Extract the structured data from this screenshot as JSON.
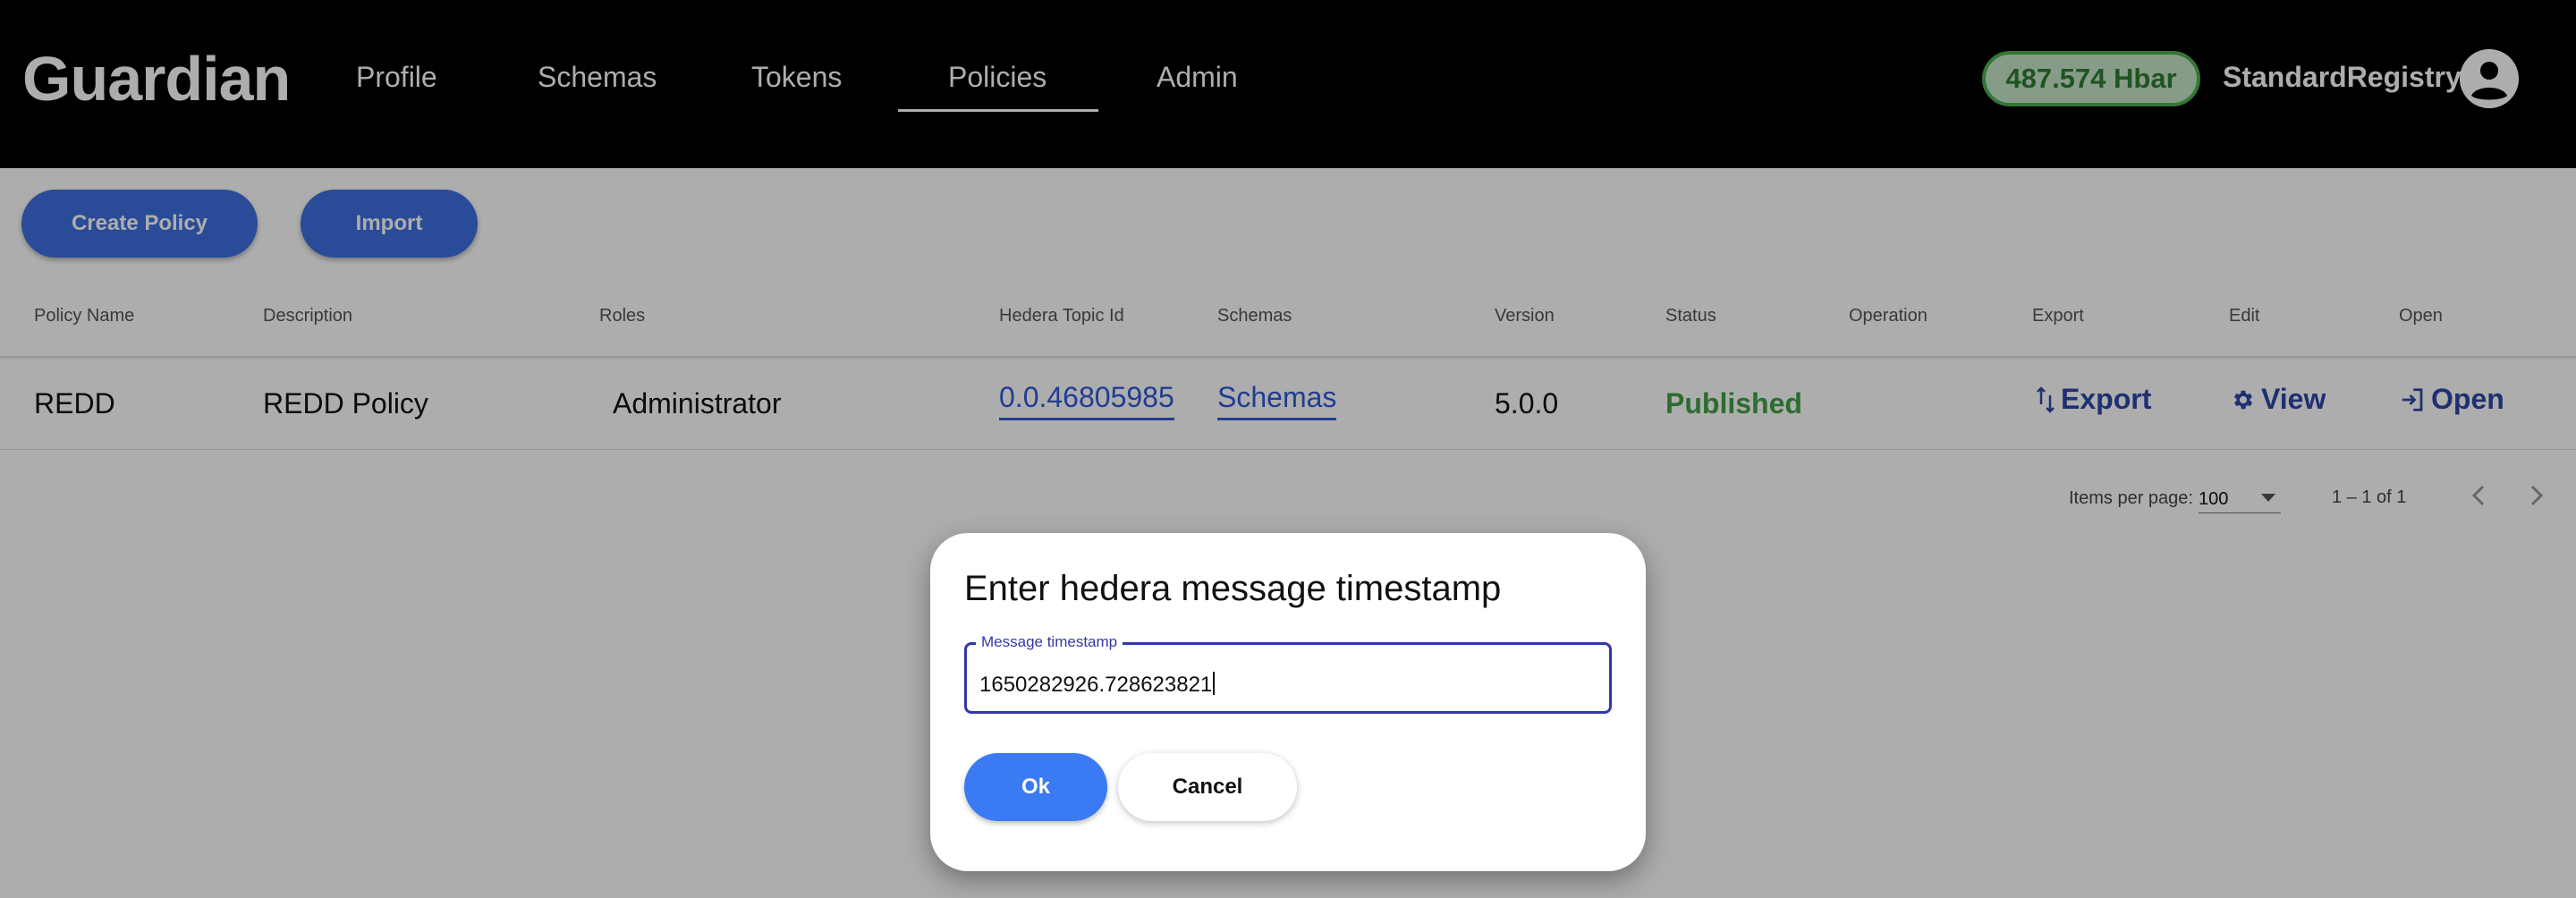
{
  "header": {
    "logo": "Guardian",
    "nav": [
      "Profile",
      "Schemas",
      "Tokens",
      "Policies",
      "Admin"
    ],
    "active_nav": "Policies",
    "balance": "487.574 Hbar",
    "username": "StandardRegistry"
  },
  "toolbar": {
    "create_policy": "Create Policy",
    "import": "Import"
  },
  "table": {
    "columns": [
      "Policy Name",
      "Description",
      "Roles",
      "Hedera Topic Id",
      "Schemas",
      "Version",
      "Status",
      "Operation",
      "Export",
      "Edit",
      "Open"
    ],
    "rows": [
      {
        "policy_name": "REDD",
        "description": "REDD Policy",
        "roles": "Administrator",
        "topic_id": "0.0.46805985",
        "schemas": "Schemas",
        "version": "5.0.0",
        "status": "Published",
        "operation": "",
        "export": "Export",
        "edit": "View",
        "open": "Open"
      }
    ]
  },
  "paginator": {
    "items_per_page_label": "Items per page:",
    "page_size": "100",
    "range": "1 – 1 of 1"
  },
  "dialog": {
    "title": "Enter hedera message timestamp",
    "field_label": "Message timestamp",
    "field_value": "1650282926.728623821",
    "ok": "Ok",
    "cancel": "Cancel"
  },
  "colors": {
    "primary": "#3f6fe0",
    "status_published": "#43a047",
    "link": "#2e5bd6",
    "balance_bg": "#c8e6c9"
  }
}
